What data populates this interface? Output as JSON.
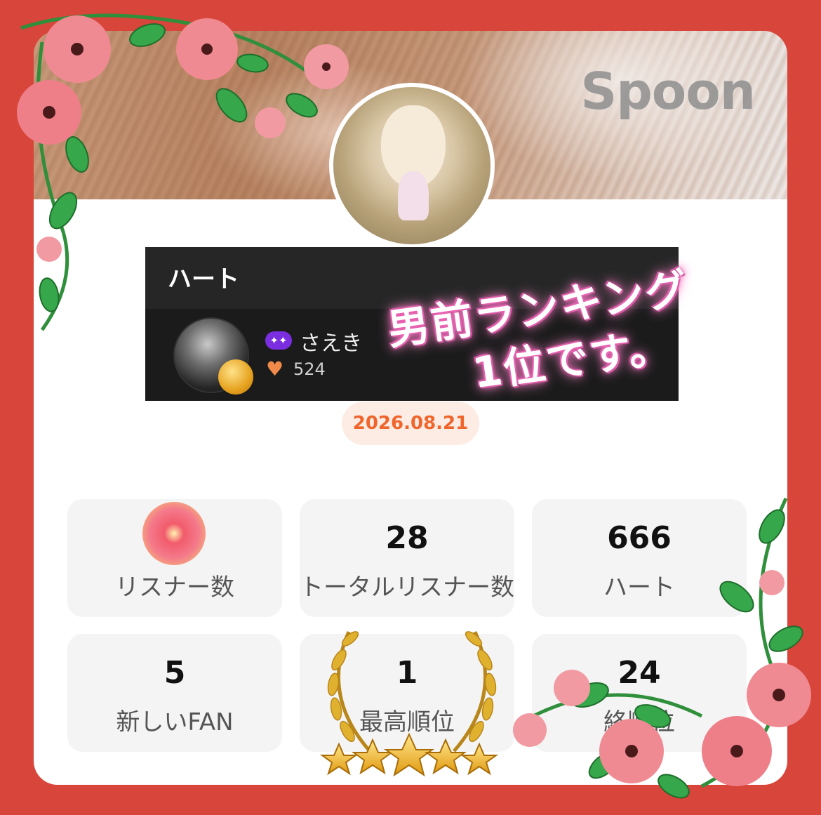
{
  "banner": {
    "logo_text": "Spoon"
  },
  "ranking_panel": {
    "title": "ハート",
    "user": {
      "tier_badge": "✦✦",
      "name": "さえき",
      "heart_count": "524"
    },
    "overlay_text": {
      "line1": "男前ランキング",
      "line2": "1位です。"
    }
  },
  "date": "2026.08.21",
  "stats": [
    {
      "value": "",
      "label": "リスナー数"
    },
    {
      "value": "28",
      "label": "トータルリスナー数"
    },
    {
      "value": "666",
      "label": "ハート"
    },
    {
      "value": "5",
      "label": "新しいFAN"
    },
    {
      "value": "1",
      "label": "最高順位"
    },
    {
      "value": "24",
      "label": "終順位"
    }
  ],
  "colors": {
    "frame": "#d8453a",
    "date_text": "#f0652c",
    "date_bg": "#fdece4",
    "heart": "#f08a4b",
    "tier_badge": "#7a2ee0",
    "overlay_glow": "#e85fb0"
  }
}
